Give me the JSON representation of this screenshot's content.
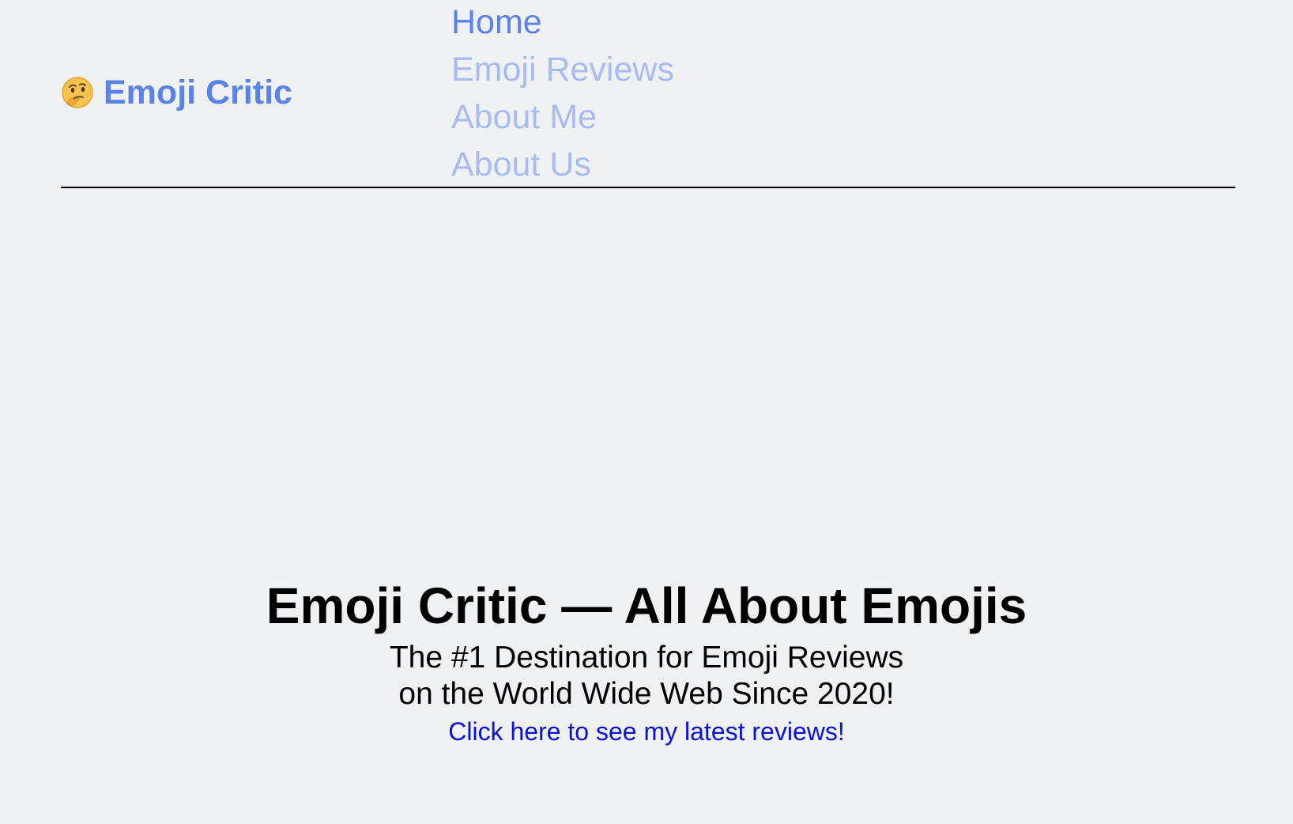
{
  "header": {
    "brand_icon": "thinking-face-emoji",
    "brand_name": "Emoji Critic",
    "nav": [
      {
        "label": "Home",
        "active": true
      },
      {
        "label": "Emoji Reviews",
        "active": false
      },
      {
        "label": "About Me",
        "active": false
      },
      {
        "label": "About Us",
        "active": false
      }
    ]
  },
  "hero": {
    "title": "Emoji Critic — All About Emojis",
    "subtitle_line1": "The #1 Destination for Emoji Reviews",
    "subtitle_line2": "on the World Wide Web Since 2020!",
    "link": "Click here to see my latest reviews!"
  },
  "colors": {
    "background": "#eff1f3",
    "brand": "#5a82e8",
    "nav_muted": "#a8bcf2",
    "link": "#0a12d8",
    "text": "#000000"
  }
}
